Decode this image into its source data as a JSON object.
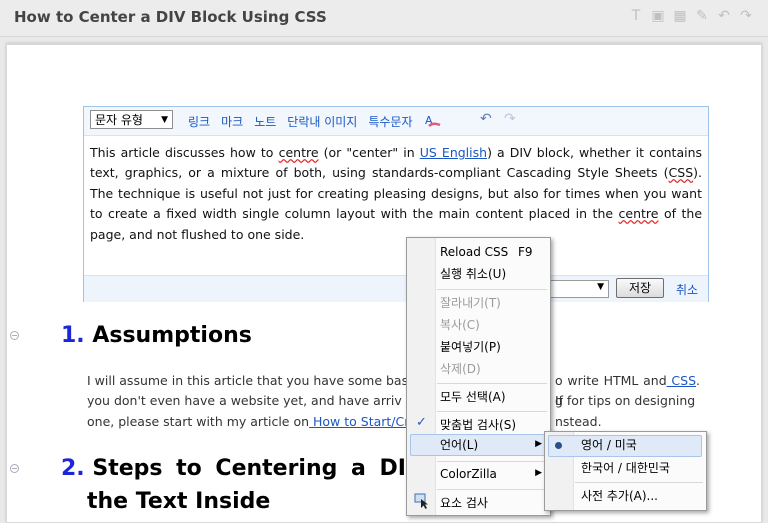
{
  "header": {
    "title": "How to Center a DIV Block Using CSS",
    "icons": [
      "text-icon",
      "image-icon",
      "table-icon",
      "tools-icon",
      "undo-icon",
      "redo-icon"
    ]
  },
  "editor": {
    "toolbar": {
      "style_select": "문자 유형",
      "links": [
        "링크",
        "마크",
        "노트",
        "단락내 이미지",
        "특수문자"
      ],
      "spell_icon": "spellcheck-icon"
    },
    "content": {
      "t1": "This article discusses how to ",
      "centre1": "centre",
      "t2": " (or \"center\" in ",
      "us_english": "US English",
      "t3": ") a DIV block, whether it contains text, graphics, or a mixture of both, using standards-compliant Cascading Style Sheets (",
      "css": "CSS",
      "t4": "). The technique is useful not just for creating pleasing designs, but also for times when you want to create a fixed width single column layout with the main content placed in the ",
      "centre2": "centre",
      "t5": " of the page, and not flushed to one side."
    },
    "footer": {
      "save_label": "저장",
      "cancel_label": "취소"
    }
  },
  "article": {
    "section1": {
      "num": "1.",
      "title": "Assumptions",
      "p1": "I will assume in this article that you have some bas",
      "p1b": "o write HTML and",
      "css_link": " CSS",
      "p1c": ". If",
      "p2": "you don't even have a website yet, and have arriv",
      "p2b": "g for tips on designing",
      "p3": "one, please start with my article on",
      "how_link": " How to Start/Cre",
      "p3b": "nstead."
    },
    "section2": {
      "num": "2.",
      "title_line1": "Steps to Centering a DIV",
      "title_line2": "the Text Inside"
    }
  },
  "context_menu": {
    "reload_css": "Reload CSS",
    "reload_shortcut": "F9",
    "undo": "실행 취소(U)",
    "cut": "잘라내기(T)",
    "copy": "복사(C)",
    "paste": "붙여넣기(P)",
    "delete": "삭제(D)",
    "select_all": "모두 선택(A)",
    "spellcheck": "맞춤법 검사(S)",
    "language": "언어(L)",
    "colorzilla": "ColorZilla",
    "inspect": "요소 검사"
  },
  "language_submenu": {
    "items": [
      "영어 / 미국",
      "한국어 / 대한민국"
    ],
    "add_dictionary": "사전 추가(A)..."
  }
}
